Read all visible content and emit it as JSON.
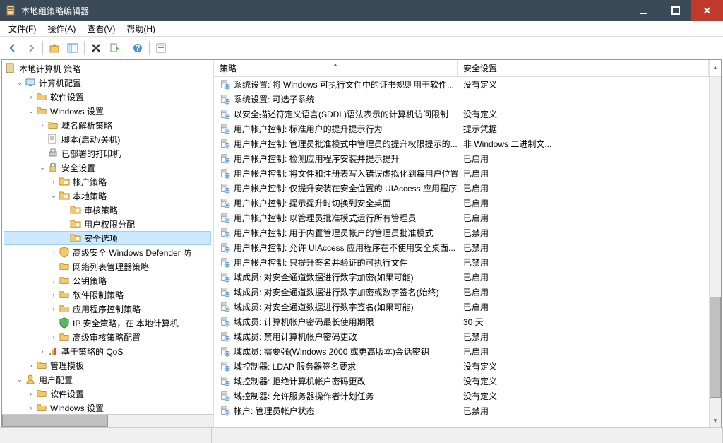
{
  "window": {
    "title": "本地组策略编辑器"
  },
  "menu": {
    "file": "文件(F)",
    "action": "操作(A)",
    "view": "查看(V)",
    "help": "帮助(H)"
  },
  "tree": {
    "root": "本地计算机 策略",
    "computer_config": "计算机配置",
    "software_settings": "软件设置",
    "windows_settings": "Windows 设置",
    "name_resolution": "域名解析策略",
    "scripts": "脚本(启动/关机)",
    "deployed_printers": "已部署的打印机",
    "security_settings": "安全设置",
    "account_policies": "帐户策略",
    "local_policies": "本地策略",
    "audit_policy": "审核策略",
    "user_rights": "用户权限分配",
    "security_options": "安全选项",
    "windows_defender": "高级安全 Windows Defender 防",
    "network_list": "网络列表管理器策略",
    "public_key": "公钥策略",
    "software_restriction": "软件限制策略",
    "app_control": "应用程序控制策略",
    "ip_security": "IP 安全策略，在 本地计算机",
    "advanced_audit": "高级审核策略配置",
    "policy_qos": "基于策略的 QoS",
    "admin_templates": "管理模板",
    "user_config": "用户配置",
    "user_software": "软件设置",
    "user_windows": "Windows 设置"
  },
  "columns": {
    "policy": "策略",
    "setting": "安全设置"
  },
  "policies": [
    {
      "name": "系统设置: 将 Windows 可执行文件中的证书规则用于软件...",
      "setting": "没有定义"
    },
    {
      "name": "系统设置: 可选子系统",
      "setting": ""
    },
    {
      "name": "以安全描述符定义语言(SDDL)语法表示的计算机访问限制",
      "setting": "没有定义"
    },
    {
      "name": "用户帐户控制: 标准用户的提升提示行为",
      "setting": "提示凭据"
    },
    {
      "name": "用户帐户控制: 管理员批准模式中管理员的提升权限提示的...",
      "setting": "非 Windows 二进制文..."
    },
    {
      "name": "用户帐户控制: 检测应用程序安装并提示提升",
      "setting": "已启用"
    },
    {
      "name": "用户帐户控制: 将文件和注册表写入错误虚拟化到每用户位置",
      "setting": "已启用"
    },
    {
      "name": "用户帐户控制: 仅提升安装在安全位置的 UIAccess 应用程序",
      "setting": "已启用"
    },
    {
      "name": "用户帐户控制: 提示提升时切换到安全桌面",
      "setting": "已启用"
    },
    {
      "name": "用户帐户控制: 以管理员批准模式运行所有管理员",
      "setting": "已启用"
    },
    {
      "name": "用户帐户控制: 用于内置管理员帐户的管理员批准模式",
      "setting": "已禁用"
    },
    {
      "name": "用户帐户控制: 允许 UIAccess 应用程序在不使用安全桌面...",
      "setting": "已禁用"
    },
    {
      "name": "用户帐户控制: 只提升签名并验证的可执行文件",
      "setting": "已禁用"
    },
    {
      "name": "域成员: 对安全通道数据进行数字加密(如果可能)",
      "setting": "已启用"
    },
    {
      "name": "域成员: 对安全通道数据进行数字加密或数字签名(始终)",
      "setting": "已启用"
    },
    {
      "name": "域成员: 对安全通道数据进行数字签名(如果可能)",
      "setting": "已启用"
    },
    {
      "name": "域成员: 计算机帐户密码最长使用期限",
      "setting": "30 天"
    },
    {
      "name": "域成员: 禁用计算机帐户密码更改",
      "setting": "已禁用"
    },
    {
      "name": "域成员: 需要强(Windows 2000 或更高版本)会话密钥",
      "setting": "已启用"
    },
    {
      "name": "域控制器: LDAP 服务器签名要求",
      "setting": "没有定义"
    },
    {
      "name": "域控制器: 拒绝计算机帐户密码更改",
      "setting": "没有定义"
    },
    {
      "name": "域控制器: 允许服务器操作者计划任务",
      "setting": "没有定义"
    },
    {
      "name": "帐户: 管理员帐户状态",
      "setting": "已禁用"
    }
  ]
}
